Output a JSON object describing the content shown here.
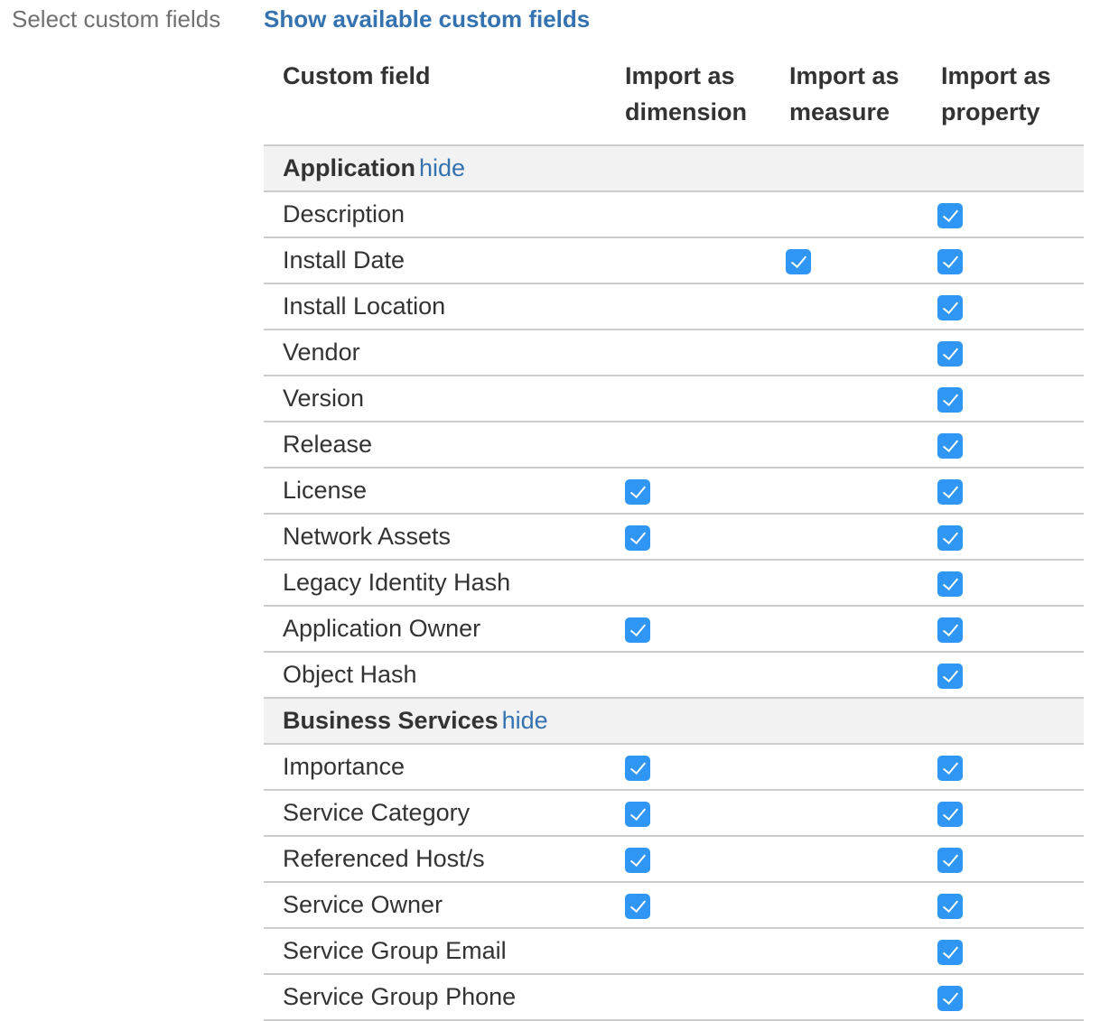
{
  "header": {
    "label": "Select custom fields",
    "link": "Show available custom fields"
  },
  "columns": [
    "Custom field",
    "Import as\ndimension",
    "Import as\nmeasure",
    "Import as\nproperty"
  ],
  "groups": [
    {
      "name": "Application",
      "hide_label": "hide",
      "rows": [
        {
          "name": "Description",
          "dimension": false,
          "measure": false,
          "property": true
        },
        {
          "name": "Install Date",
          "dimension": false,
          "measure": true,
          "property": true
        },
        {
          "name": "Install Location",
          "dimension": false,
          "measure": false,
          "property": true
        },
        {
          "name": "Vendor",
          "dimension": false,
          "measure": false,
          "property": true
        },
        {
          "name": "Version",
          "dimension": false,
          "measure": false,
          "property": true
        },
        {
          "name": "Release",
          "dimension": false,
          "measure": false,
          "property": true
        },
        {
          "name": "License",
          "dimension": true,
          "measure": false,
          "property": true
        },
        {
          "name": "Network Assets",
          "dimension": true,
          "measure": false,
          "property": true
        },
        {
          "name": "Legacy Identity Hash",
          "dimension": false,
          "measure": false,
          "property": true
        },
        {
          "name": "Application Owner",
          "dimension": true,
          "measure": false,
          "property": true
        },
        {
          "name": "Object Hash",
          "dimension": false,
          "measure": false,
          "property": true
        }
      ]
    },
    {
      "name": "Business Services",
      "hide_label": "hide",
      "rows": [
        {
          "name": "Importance",
          "dimension": true,
          "measure": false,
          "property": true
        },
        {
          "name": "Service Category",
          "dimension": true,
          "measure": false,
          "property": true
        },
        {
          "name": "Referenced Host/s",
          "dimension": true,
          "measure": false,
          "property": true
        },
        {
          "name": "Service Owner",
          "dimension": true,
          "measure": false,
          "property": true
        },
        {
          "name": "Service Group Email",
          "dimension": false,
          "measure": false,
          "property": true
        },
        {
          "name": "Service Group Phone",
          "dimension": false,
          "measure": false,
          "property": true
        }
      ]
    }
  ],
  "colors": {
    "link": "#3572b0",
    "checkbox": "#2f97f3",
    "group_bg": "#f2f2f2",
    "border": "#cccccc"
  }
}
